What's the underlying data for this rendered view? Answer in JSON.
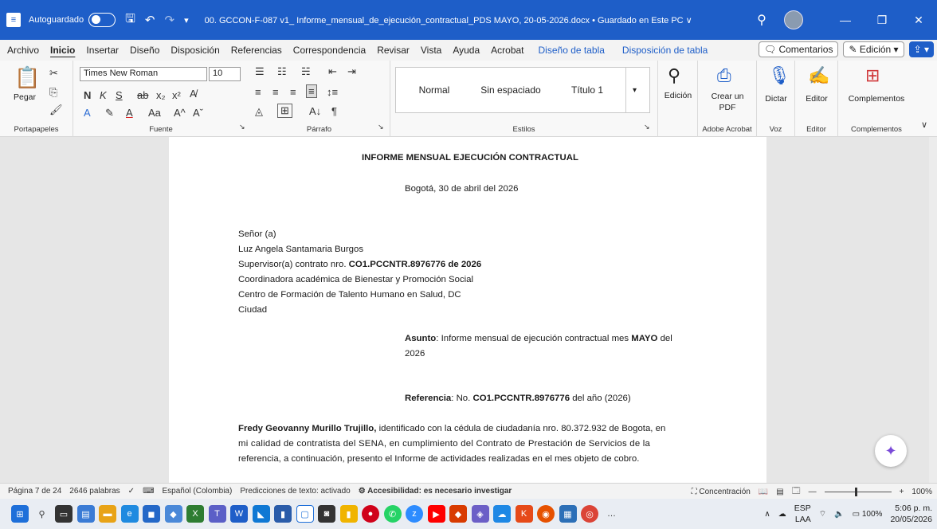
{
  "titlebar": {
    "autosave_label": "Autoguardado",
    "title": "00. GCCON-F-087 v1_ Informe_mensual_de_ejecución_contractual_PDS MAYO, 20-05-2026.docx • Guardado en Este PC ∨"
  },
  "menu": {
    "items": [
      "Archivo",
      "Inicio",
      "Insertar",
      "Diseño",
      "Disposición",
      "Referencias",
      "Correspondencia",
      "Revisar",
      "Vista",
      "Ayuda",
      "Acrobat"
    ],
    "context_items": [
      "Diseño de tabla",
      "Disposición de tabla"
    ],
    "comments": "Comentarios",
    "edit_mode": "Edición"
  },
  "ribbon": {
    "paste": "Pegar",
    "font_name": "Times New Roman",
    "font_size": "10",
    "styles": [
      "Normal",
      "Sin espaciado",
      "Título 1"
    ],
    "editing": "Edición",
    "create_pdf": "Crear un PDF",
    "dictate": "Dictar",
    "editor": "Editor",
    "addins": "Complementos",
    "groups": {
      "clipboard": "Portapapeles",
      "font": "Fuente",
      "paragraph": "Párrafo",
      "styles": "Estilos",
      "acrobat": "Adobe Acrobat",
      "voice": "Voz",
      "editor": "Editor",
      "addins": "Complementos"
    }
  },
  "document": {
    "heading": "INFORME MENSUAL EJECUCIÓN CONTRACTUAL",
    "date_line": "Bogotá, 30 de abril del 2026",
    "recipient": {
      "salutation": "Señor (a)",
      "name": "Luz Angela Santamaria Burgos",
      "supervisor_prefix": "Supervisor(a) contrato nro. ",
      "contract": "CO1.PCCNTR.8976776 de 2026",
      "role": "Coordinadora académica de Bienestar y Promoción Social",
      "center": "Centro de Formación de Talento Humano en Salud, DC",
      "city": "Ciudad"
    },
    "subject": {
      "label": "Asunto",
      "text_a": ": Informe mensual de ejecución contractual mes ",
      "month": "MAYO",
      "text_b": " del",
      "year": "2026"
    },
    "reference": {
      "label": "Referencia",
      "text_a": ": No. ",
      "number": "CO1.PCCNTR.8976776",
      "text_b": " del año (2026)"
    },
    "body": {
      "name": "Fredy Geovanny Murillo Trujillo,",
      "line1": " identificado con la cédula de ciudadanía nro. 80.372.932 de Bogota, en",
      "line2": "mi calidad de contratista del SENA, en cumplimiento del Contrato de Prestación de Servicios de la",
      "line3": "referencia, a continuación, presento el Informe de actividades realizadas en el mes objeto de cobro."
    }
  },
  "statusbar": {
    "page": "Página 7 de 24",
    "words": "2646 palabras",
    "language": "Español (Colombia)",
    "predictions": "Predicciones de texto: activado",
    "accessibility": "Accesibilidad: es necesario investigar",
    "focus": "Concentración",
    "zoom": "100%"
  },
  "taskbar": {
    "lang_top": "ESP",
    "lang_bottom": "LAA",
    "battery": "100%",
    "time": "5:06 p. m.",
    "date": "20/05/2026"
  }
}
